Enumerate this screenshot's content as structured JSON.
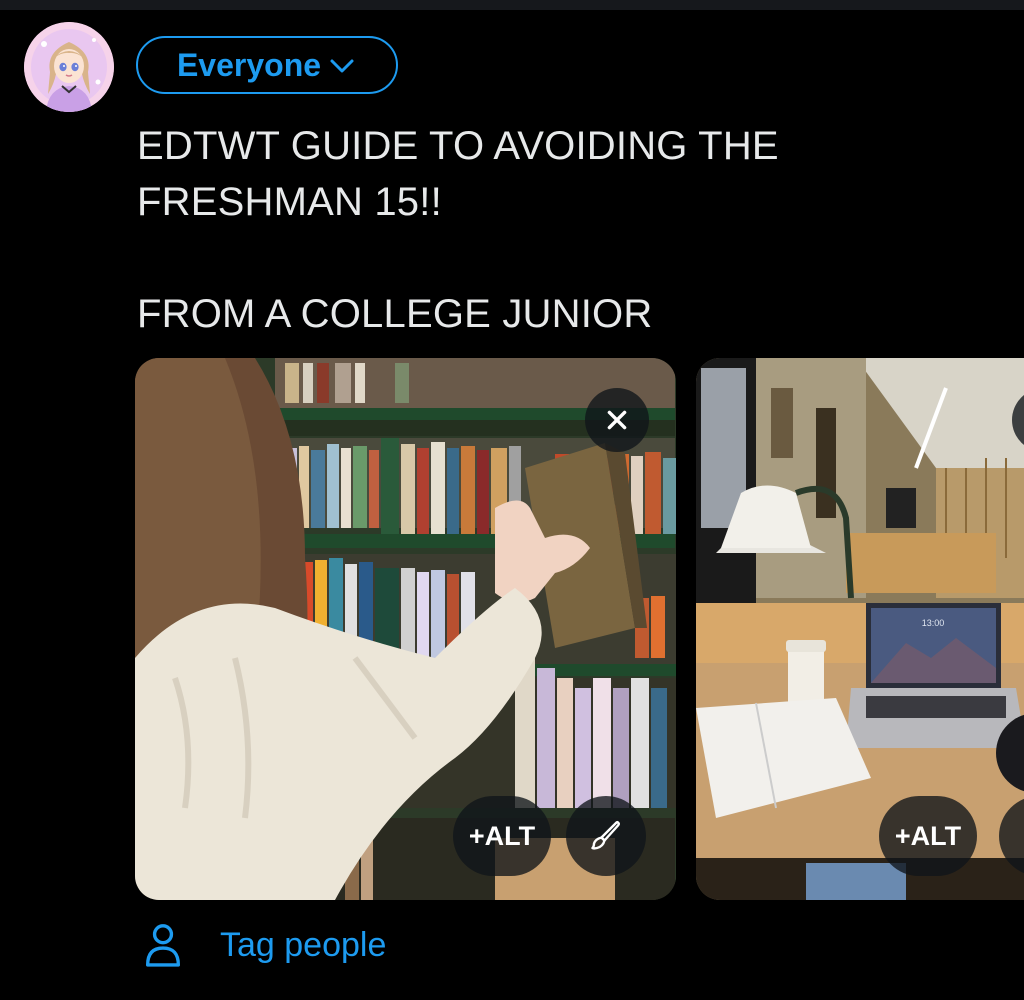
{
  "composer": {
    "audience_label": "Everyone",
    "tweet_text": "EDTWT GUIDE TO AVOIDING THE\nFRESHMAN 15!!\n\nFROM A COLLEGE JUNIOR"
  },
  "media": [
    {
      "alt_label": "+ALT",
      "remove_icon": "close-icon",
      "edit_icon": "brush-icon"
    },
    {
      "alt_label": "+ALT",
      "remove_icon": "close-icon",
      "edit_icon": "brush-icon",
      "laptop_clock": "13:00"
    }
  ],
  "tag_people": {
    "label": "Tag people",
    "icon": "person-icon"
  },
  "colors": {
    "accent": "#1d9bf0",
    "background": "#000000",
    "text": "#e7e9ea"
  }
}
